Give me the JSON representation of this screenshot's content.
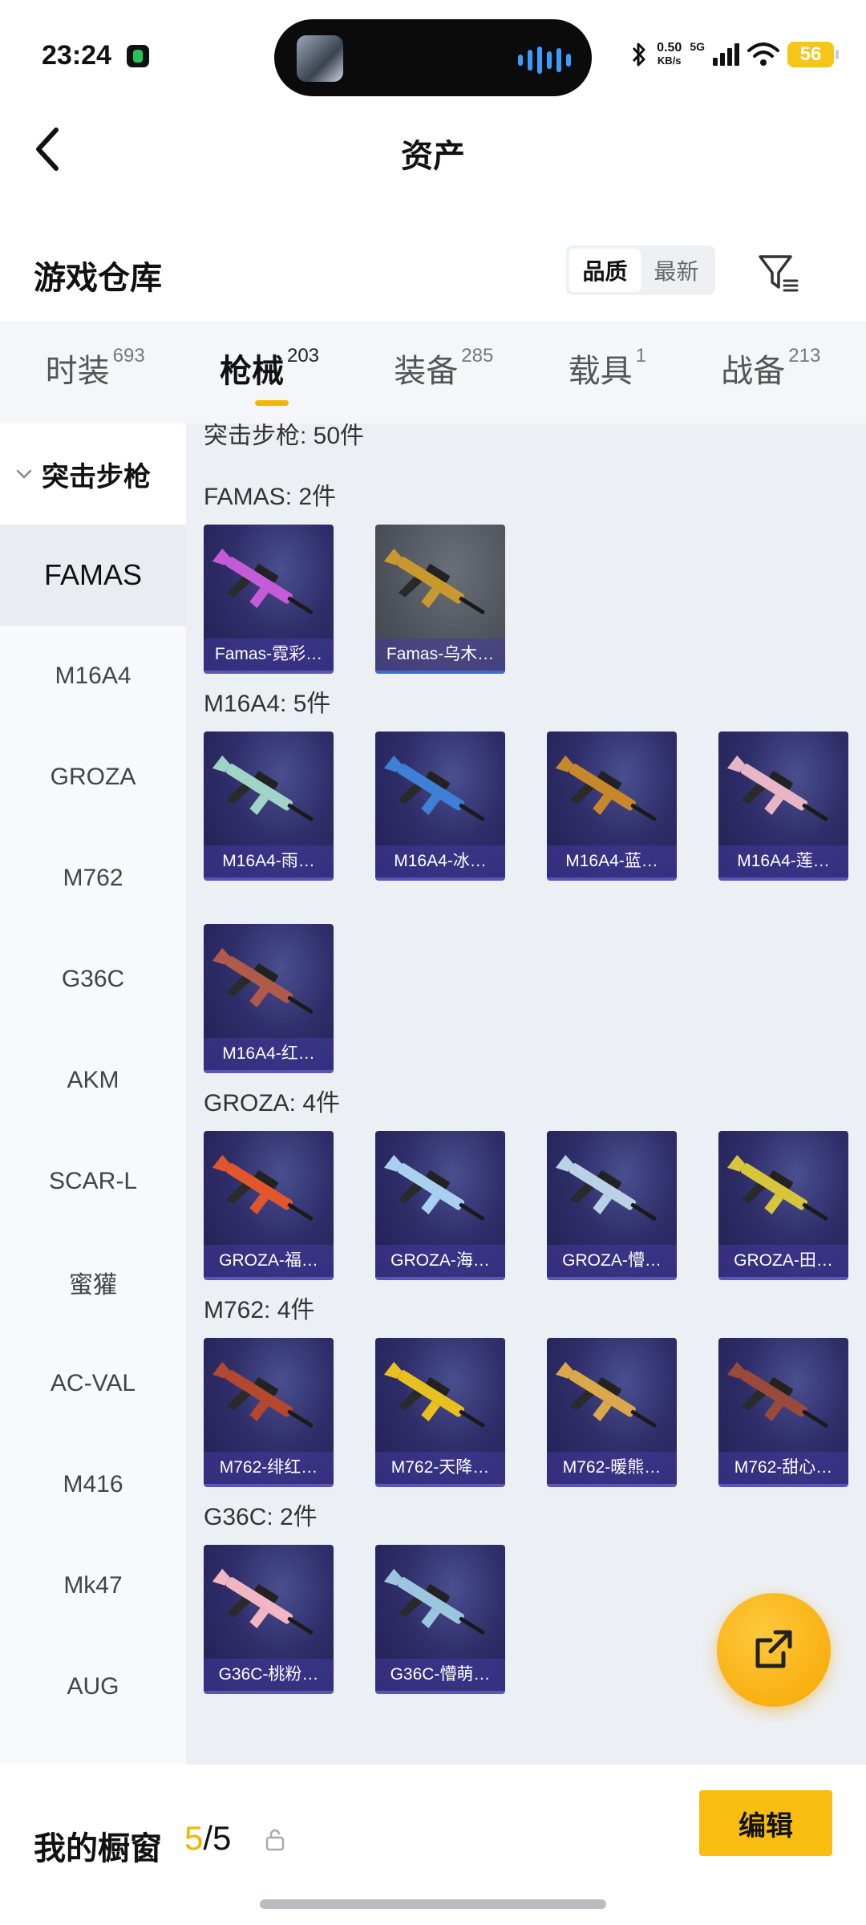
{
  "status_bar": {
    "time": "23:24",
    "net_speed_value": "0.50",
    "net_speed_unit": "KB/s",
    "network": "5G",
    "battery": "56"
  },
  "nav": {
    "title": "资产",
    "back_icon": "chevron-left-icon"
  },
  "header": {
    "title": "游戏仓库",
    "sort_options": [
      "品质",
      "最新"
    ],
    "sort_selected": "品质",
    "filter_icon": "filter-icon"
  },
  "tabs": [
    {
      "label": "时装",
      "count": "693"
    },
    {
      "label": "枪械",
      "count": "203",
      "active": true
    },
    {
      "label": "装备",
      "count": "285"
    },
    {
      "label": "载具",
      "count": "1"
    },
    {
      "label": "战备",
      "count": "213"
    }
  ],
  "sidebar": {
    "group": "突击步枪",
    "items": [
      "FAMAS",
      "M16A4",
      "GROZA",
      "M762",
      "G36C",
      "AKM",
      "SCAR-L",
      "蜜獾",
      "AC-VAL",
      "M416",
      "Mk47",
      "AUG"
    ],
    "active": "FAMAS"
  },
  "content": {
    "group_header": "突击步枪: 50件",
    "sections": [
      {
        "header": "FAMAS: 2件",
        "items": [
          {
            "label": "Famas-霓彩…",
            "style": "purple",
            "color": "#c65bd8"
          },
          {
            "label": "Famas-乌木…",
            "style": "gray",
            "color": "#c9992f"
          }
        ]
      },
      {
        "header": "M16A4: 5件",
        "items": [
          {
            "label": "M16A4-雨…",
            "style": "purple",
            "color": "#9fd4c6"
          },
          {
            "label": "M16A4-冰…",
            "style": "purple",
            "color": "#3e7fd8"
          },
          {
            "label": "M16A4-蓝…",
            "style": "purple",
            "color": "#c8882a"
          },
          {
            "label": "M16A4-莲…",
            "style": "purple",
            "color": "#e8b6c4"
          },
          {
            "label": "M16A4-红…",
            "style": "purple",
            "color": "#b05a4a"
          }
        ]
      },
      {
        "header": "GROZA: 4件",
        "items": [
          {
            "label": "GROZA-福…",
            "style": "purple",
            "color": "#e2562e"
          },
          {
            "label": "GROZA-海…",
            "style": "purple",
            "color": "#a9d0ef"
          },
          {
            "label": "GROZA-懵…",
            "style": "purple",
            "color": "#b9d2e6"
          },
          {
            "label": "GROZA-田…",
            "style": "purple",
            "color": "#d8c53c"
          }
        ]
      },
      {
        "header": "M762: 4件",
        "items": [
          {
            "label": "M762-绯红…",
            "style": "purple",
            "color": "#b4472f"
          },
          {
            "label": "M762-天降…",
            "style": "purple",
            "color": "#e8c01f"
          },
          {
            "label": "M762-暖熊…",
            "style": "purple",
            "color": "#d9a94a"
          },
          {
            "label": "M762-甜心…",
            "style": "purple",
            "color": "#9a4a3a"
          }
        ]
      },
      {
        "header": "G36C: 2件",
        "items": [
          {
            "label": "G36C-桃粉…",
            "style": "purple",
            "color": "#f0b6c2"
          },
          {
            "label": "G36C-懵萌…",
            "style": "purple",
            "color": "#9cc6de"
          }
        ]
      }
    ]
  },
  "fab": {
    "icon": "share-external-icon"
  },
  "bottom_bar": {
    "showcase_label": "我的橱窗",
    "showcase_current": "5",
    "showcase_total": "/5",
    "lock_icon": "lock-icon",
    "edit_label": "编辑"
  },
  "colors": {
    "accent": "#f5b400",
    "edit_button": "#f8bd10",
    "card_purple": "#2f2e6a"
  }
}
